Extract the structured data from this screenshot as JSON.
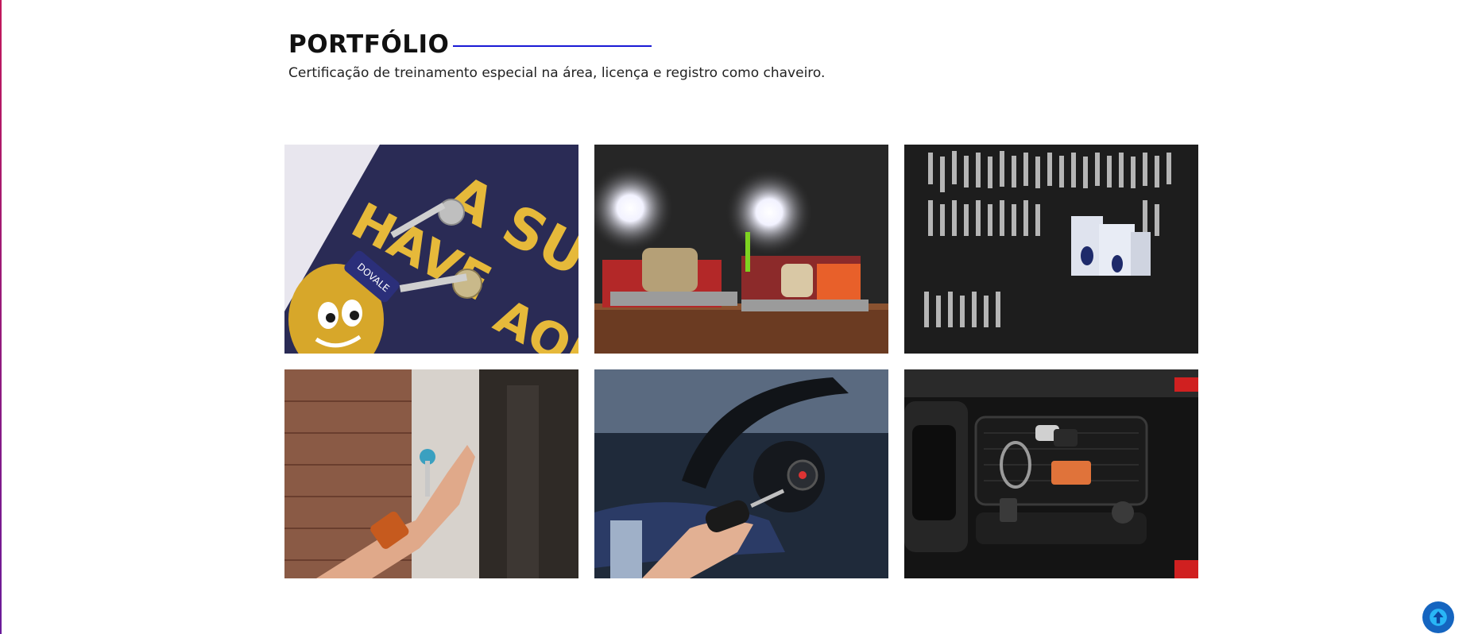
{
  "portfolio": {
    "title": "PORTFÓLIO",
    "subtitle": "Certificação de treinamento especial na área, licença e registro como chaveiro."
  },
  "gallery": {
    "images": [
      {
        "id": "keys-on-banner",
        "banner_text": "DOVALE"
      },
      {
        "id": "key-cutting-machines"
      },
      {
        "id": "key-wall-display"
      },
      {
        "id": "hand-holding-key"
      },
      {
        "id": "car-key-ignition"
      },
      {
        "id": "keys-on-car-console"
      }
    ]
  },
  "scroll_top": {
    "icon": "arrow-up-icon"
  },
  "colors": {
    "accent_line": "#1a1ad6",
    "scroll_button": "#1565c0"
  }
}
